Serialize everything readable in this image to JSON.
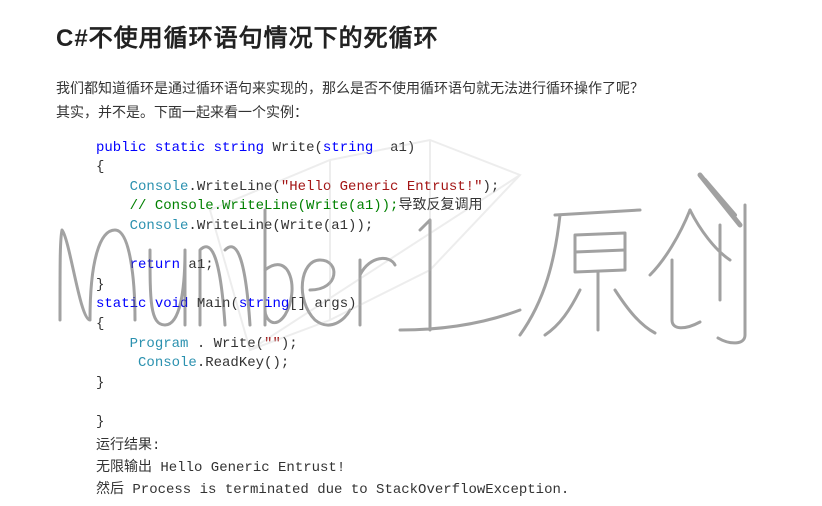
{
  "title": "C#不使用循环语句情况下的死循环",
  "intro_line1": "我们都知道循环是通过循环语句来实现的，那么是否不使用循环语句就无法进行循环操作了呢？",
  "intro_line2": "其实，并不是。下面一起来看一个实例：",
  "code": {
    "l1_kw1": "public",
    "l1_kw2": "static",
    "l1_kw3": "string",
    "l1_name": " Write(",
    "l1_kw4": "string",
    "l1_end": "  a1)",
    "l2": "{",
    "l3_obj": "Console",
    "l3_mid": ".WriteLine(",
    "l3_str": "\"Hello Generic Entrust!\"",
    "l3_end": ");",
    "l4_cmt": "// Console.WriteLine(Write(a1));",
    "l4_cn": "导致反复调用",
    "l5_obj": "Console",
    "l5_end": ".WriteLine(Write(a1));",
    "l6": "",
    "l7_kw": "return",
    "l7_end": " a1;",
    "l8": "}",
    "l9_kw1": "static",
    "l9_kw2": "void",
    "l9_name": " Main(",
    "l9_kw3": "string",
    "l9_end": "[] args)",
    "l10": "{",
    "l11_obj": "Program",
    "l11_mid": " . Write(",
    "l11_str": "\"\"",
    "l11_end": ");",
    "l12_obj": "Console",
    "l12_end": ".ReadKey();",
    "l13": "}",
    "l14": "",
    "l15": "}"
  },
  "outro": {
    "r1": "运行结果:",
    "r2": "无限输出 Hello Generic Entrust!",
    "r3": "然后 Process is terminated due to StackOverflowException."
  },
  "watermark_text": "number 1 原创"
}
